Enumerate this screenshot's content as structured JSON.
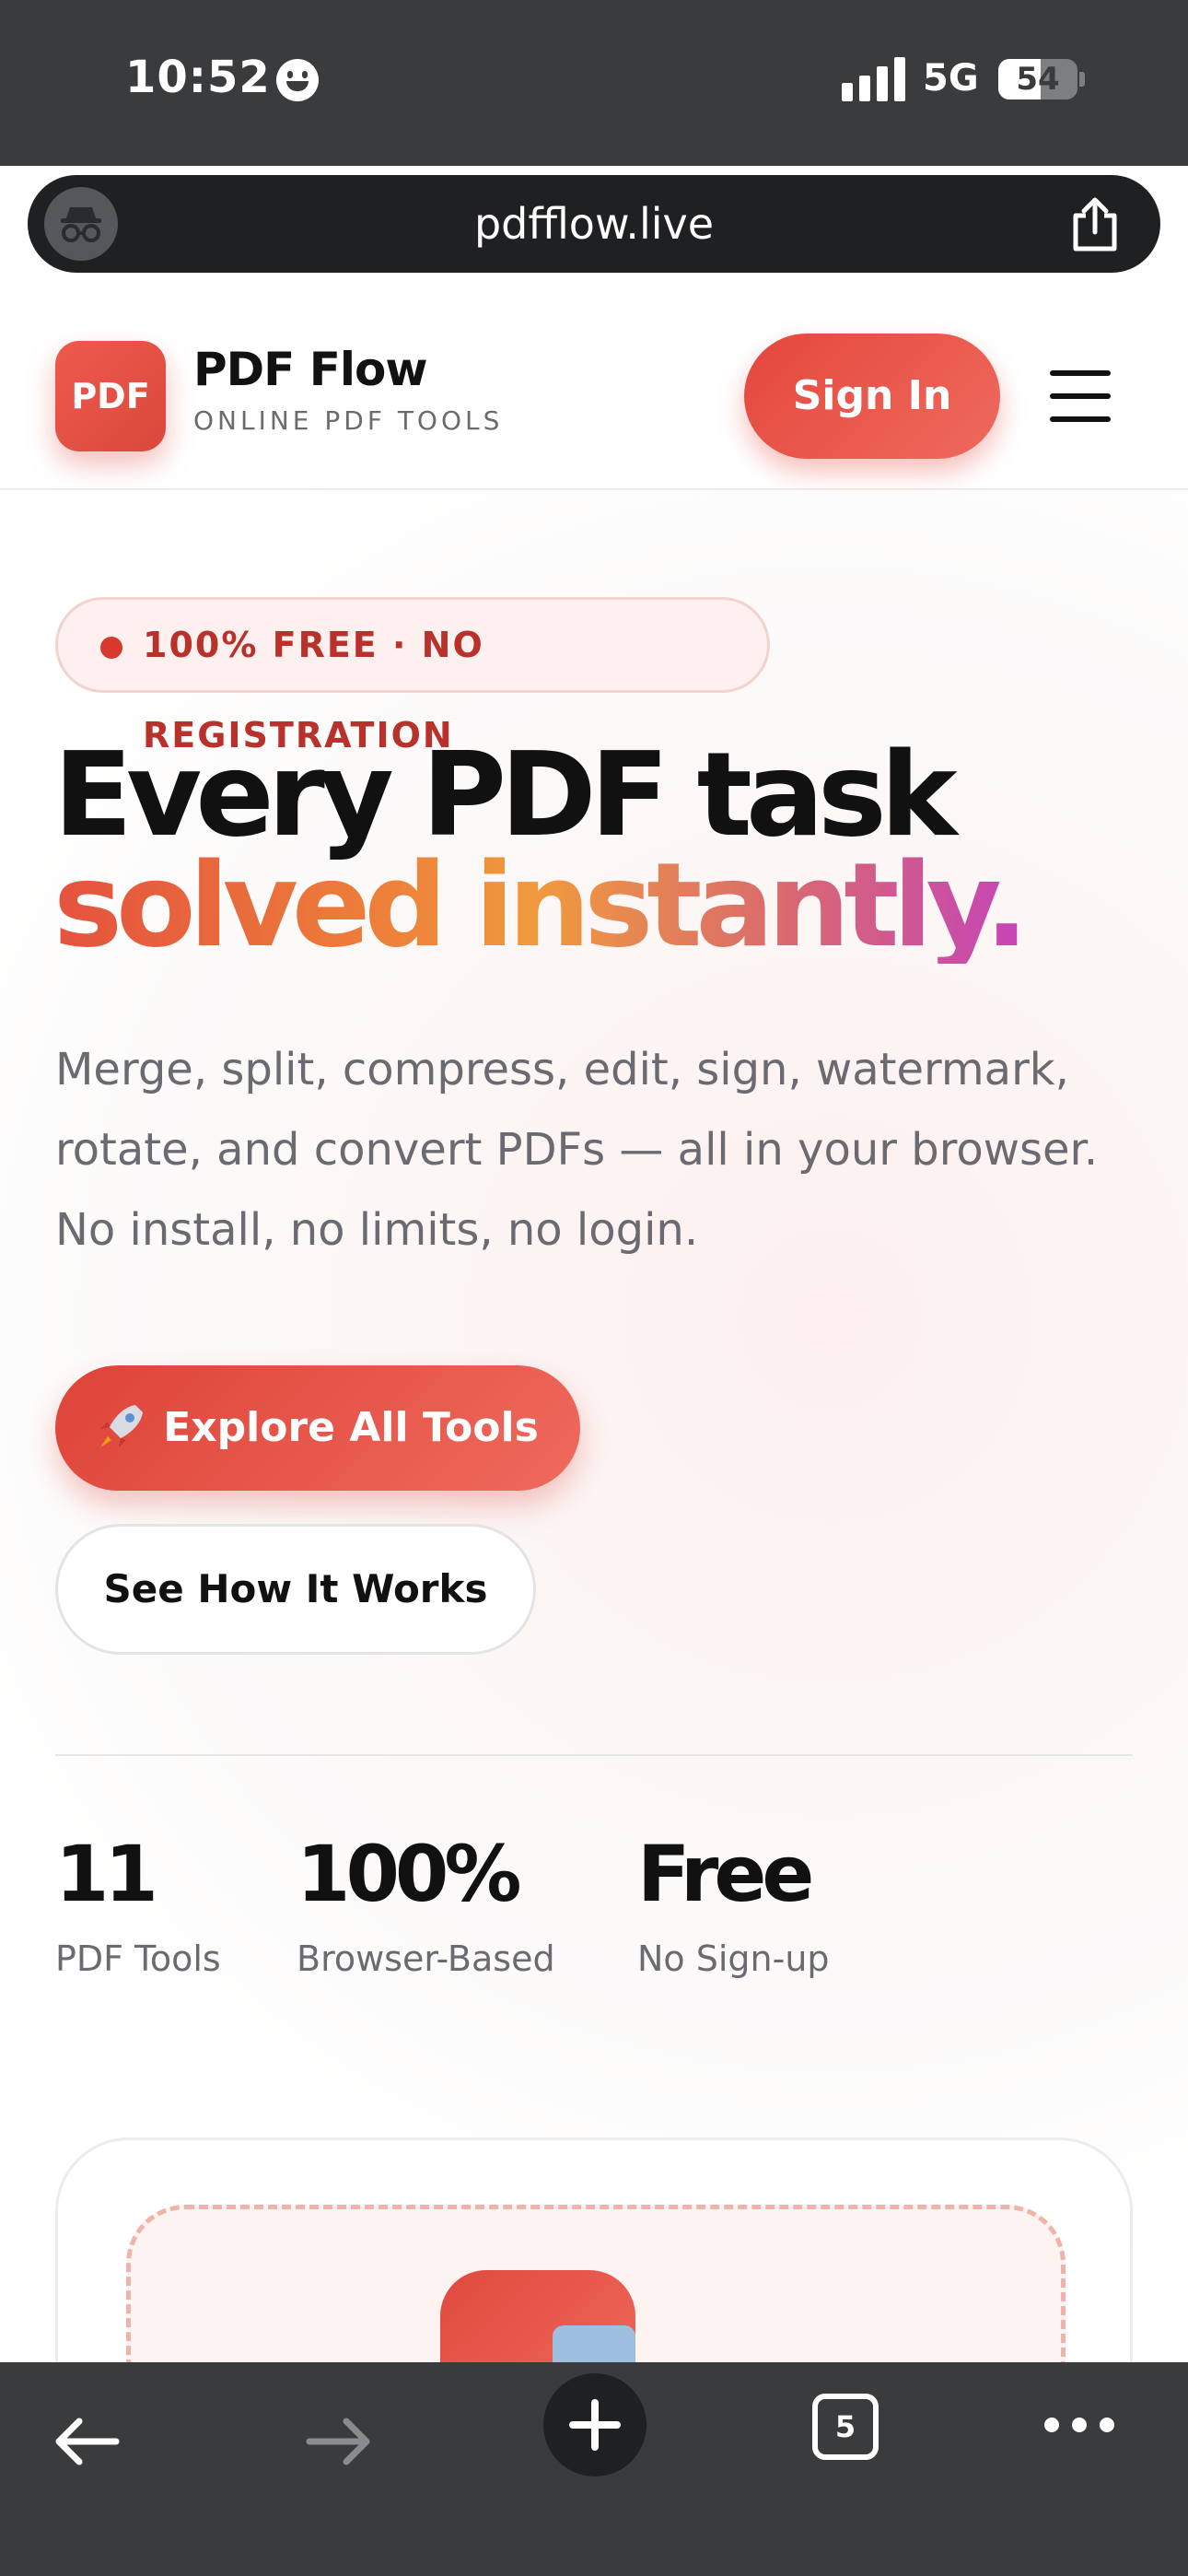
{
  "status_bar": {
    "time": "10:52",
    "network": "5G",
    "battery": "54",
    "battery_level": 0.54
  },
  "browser": {
    "url": "pdfflow.live",
    "open_tabs": "5",
    "icons": [
      "incognito-icon",
      "share-icon",
      "back-arrow-icon",
      "forward-arrow-icon",
      "plus-icon",
      "tabs-icon",
      "more-icon"
    ]
  },
  "header": {
    "logo_text": "PDF",
    "brand_name": "PDF Flow",
    "brand_tagline": "ONLINE PDF TOOLS",
    "signin_label": "Sign In",
    "menu_icon": "hamburger-menu-icon"
  },
  "hero": {
    "badge": "100% FREE · NO REGISTRATION",
    "headline_line1": "Every PDF task",
    "headline_line2": "solved instantly.",
    "description": "Merge, split, compress, edit, sign, watermark, rotate, and convert PDFs — all in your browser. No install, no limits, no login.",
    "primary_button": "Explore All Tools",
    "primary_button_icon": "rocket-icon",
    "secondary_button": "See How It Works"
  },
  "stats": [
    {
      "value": "11",
      "label": "PDF Tools"
    },
    {
      "value": "100%",
      "label": "Browser-Based"
    },
    {
      "value": "Free",
      "label": "No Sign-up"
    }
  ],
  "colors": {
    "accent": "#e4473c",
    "badge_text": "#b8312a",
    "browser_chrome": "#3a3b3d",
    "gradient": [
      "#e4523f",
      "#f09a3e",
      "#c545b8"
    ]
  }
}
